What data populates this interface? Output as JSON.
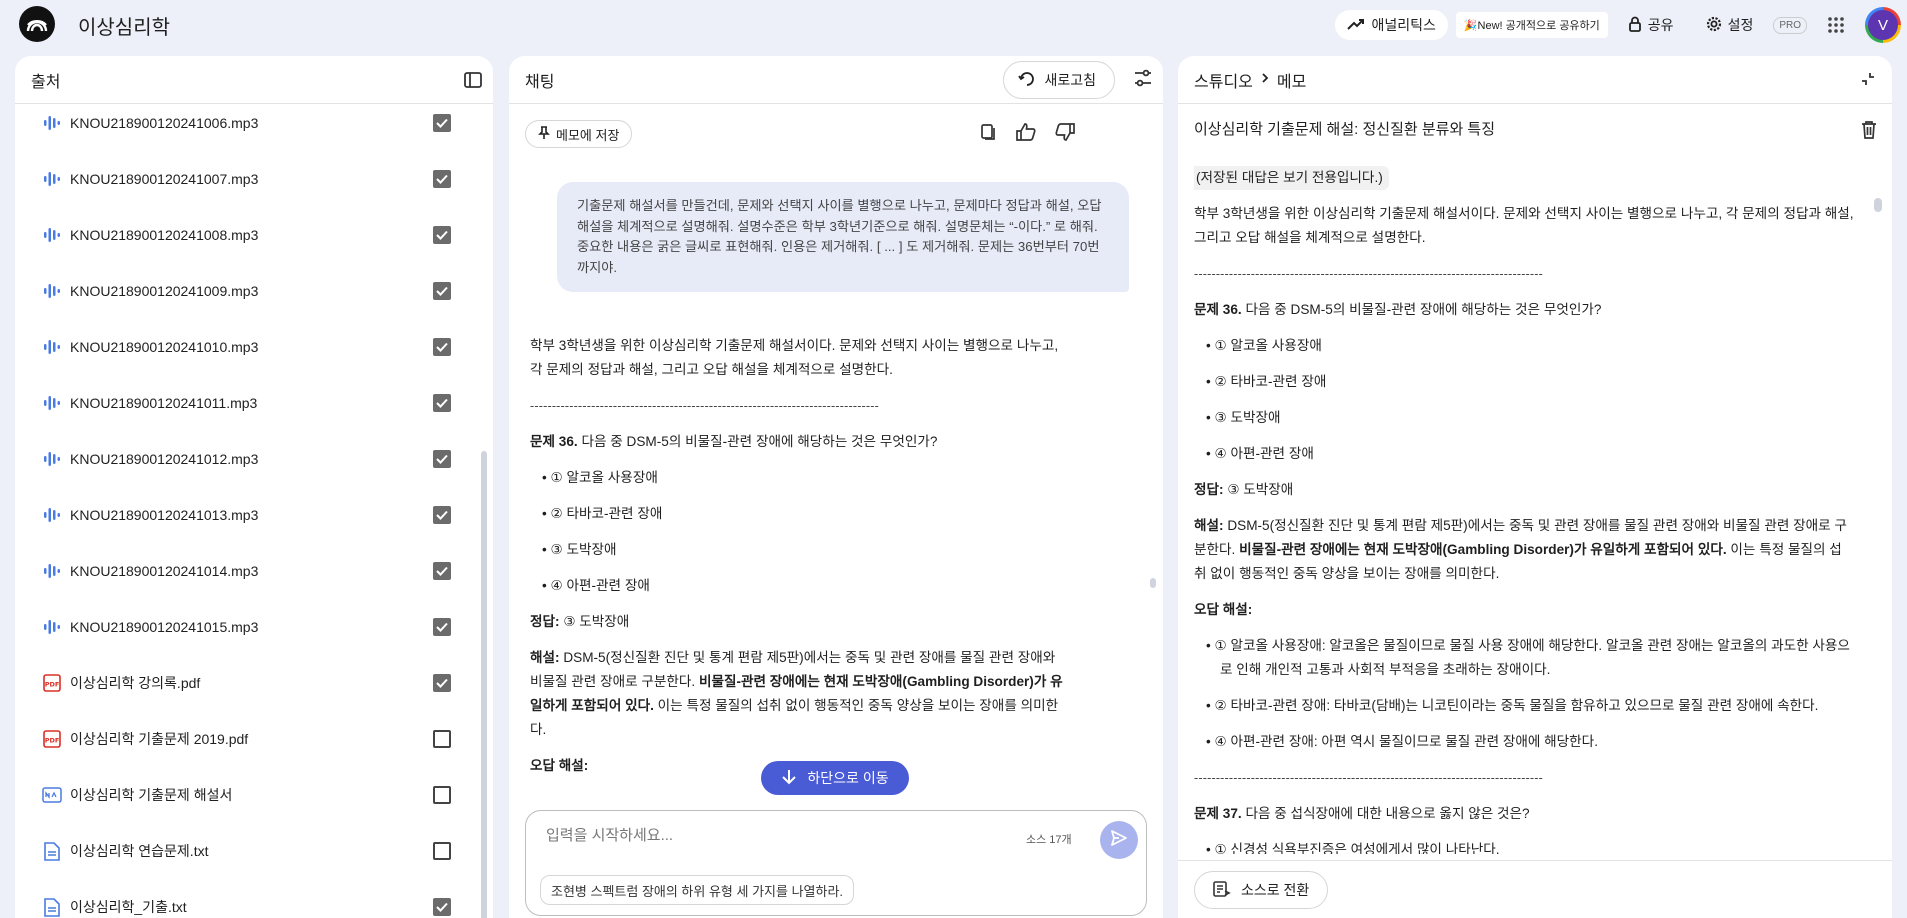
{
  "header": {
    "app_title": "이상심리학",
    "analytics_label": "애널리틱스",
    "new_share_label": "🎉New! 공개적으로 공유하기",
    "share_label": "공유",
    "settings_label": "설정",
    "pro_badge": "PRO",
    "avatar_letter": "V"
  },
  "sources": {
    "title": "출처",
    "items": [
      {
        "name": "KNOU218900120241006.mp3",
        "type": "audio",
        "checked": true
      },
      {
        "name": "KNOU218900120241007.mp3",
        "type": "audio",
        "checked": true
      },
      {
        "name": "KNOU218900120241008.mp3",
        "type": "audio",
        "checked": true
      },
      {
        "name": "KNOU218900120241009.mp3",
        "type": "audio",
        "checked": true
      },
      {
        "name": "KNOU218900120241010.mp3",
        "type": "audio",
        "checked": true
      },
      {
        "name": "KNOU218900120241011.mp3",
        "type": "audio",
        "checked": true
      },
      {
        "name": "KNOU218900120241012.mp3",
        "type": "audio",
        "checked": true
      },
      {
        "name": "KNOU218900120241013.mp3",
        "type": "audio",
        "checked": true
      },
      {
        "name": "KNOU218900120241014.mp3",
        "type": "audio",
        "checked": true
      },
      {
        "name": "KNOU218900120241015.mp3",
        "type": "audio",
        "checked": true
      },
      {
        "name": "이상심리학 강의록.pdf",
        "type": "pdf",
        "checked": true
      },
      {
        "name": "이상심리학 기출문제 2019.pdf",
        "type": "pdf",
        "checked": false
      },
      {
        "name": "이상심리학 기출문제 해설서",
        "type": "note",
        "checked": false
      },
      {
        "name": "이상심리학 연습문제.txt",
        "type": "text",
        "checked": false
      },
      {
        "name": "이상심리학_기출.txt",
        "type": "text",
        "checked": true
      }
    ]
  },
  "chat": {
    "title": "채팅",
    "refresh_label": "새로고침",
    "save_memo_label": "메모에 저장",
    "user_message": "기출문제 해설서를 만들건데, 문제와 선택지 사이를 별행으로 나누고, 문제마다 정답과 해설, 오답해설을 체계적으로 설명해줘. 설명수준은 학부 3학년기준으로 해줘. 설명문체는 “-이다.” 로 해줘. 중요한 내용은 굵은 글씨로 표현해줘. 인용은 제거해줘. [ ... ] 도 제거해줘. 문제는 36번부터 70번까지야.",
    "intro": "학부 3학년생을 위한 이상심리학 기출문제 해설서이다. 문제와 선택지 사이는 별행으로 나누고, 각 문제의 정답과 해설, 그리고 오답 해설을 체계적으로 설명한다.",
    "divider": "--------------------------------------------------------------------------------",
    "q_label": "문제 36.",
    "q_text": " 다음 중 DSM-5의 비물질-관련 장애에 해당하는 것은 무엇인가?",
    "opt1": "① 알코올 사용장애",
    "opt2": "② 타바코-관련 장애",
    "opt3": "③ 도박장애",
    "opt4": "④ 아편-관련 장애",
    "answer_label": "정답:",
    "answer_text": " ③ 도박장애",
    "exp_label": "해설:",
    "exp_text1": " DSM-5(정신질환 진단 및 통계 편람 제5판)에서는 중독 및 관련 장애를 물질 관련 장애와 비물질 관련 장애로 구분한다. ",
    "exp_bold": "비물질-관련 장애에는 현재 도박장애(Gambling Disorder)가 유일하게 포함되어 있다.",
    "exp_text2": " 이는 특정 물질의 섭취 없이 행동적인 중독 양상을 보이는 장애를 의미한다.",
    "wrong_label": "오답 해설:",
    "goto_bottom_label": "하단으로 이동",
    "input_placeholder": "입력을 시작하세요...",
    "source_count": "소스 17개",
    "suggestion": "조현병 스펙트럼 장애의 하위 유형 세 가지를 나열하라."
  },
  "studio": {
    "crumb_root": "스튜디오",
    "crumb_current": "메모",
    "note_title": "이상심리학 기출문제 해설: 정신질환 분류와 특징",
    "readonly_notice": "(저장된 대답은 보기 전용입니다.)",
    "intro": "학부 3학년생을 위한 이상심리학 기출문제 해설서이다. 문제와 선택지 사이는 별행으로 나누고, 각 문제의 정답과 해설, 그리고 오답 해설을 체계적으로 설명한다.",
    "divider": "--------------------------------------------------------------------------------",
    "q36_label": "문제 36.",
    "q36_text": " 다음 중 DSM-5의 비물질-관련 장애에 해당하는 것은 무엇인가?",
    "opt1": "① 알코올 사용장애",
    "opt2": "② 타바코-관련 장애",
    "opt3": "③ 도박장애",
    "opt4": "④ 아편-관련 장애",
    "answer_label": "정답:",
    "answer_text": " ③ 도박장애",
    "exp_label": "해설:",
    "exp_text1": " DSM-5(정신질환 진단 및 통계 편람 제5판)에서는 중독 및 관련 장애를 물질 관련 장애와 비물질 관련 장애로 구분한다. ",
    "exp_bold": "비물질-관련 장애에는 현재 도박장애(Gambling Disorder)가 유일하게 포함되어 있다.",
    "exp_text2": " 이는 특정 물질의 섭취 없이 행동적인 중독 양상을 보이는 장애를 의미한다.",
    "wrong_label": "오답 해설:",
    "wrong1": "① 알코올 사용장애: 알코올은 물질이므로 물질 사용 장애에 해당한다. 알코올 관련 장애는 알코올의 과도한 사용으로 인해 개인적 고통과 사회적 부적응을 초래하는 장애이다.",
    "wrong2": "② 타바코-관련 장애: 타바코(담배)는 니코틴이라는 중독 물질을 함유하고 있으므로 물질 관련 장애에 속한다.",
    "wrong4": "④ 아편-관련 장애: 아편 역시 물질이므로 물질 관련 장애에 해당한다.",
    "q37_label": "문제 37.",
    "q37_text": " 다음 중 섭식장애에 대한 내용으로 옳지 않은 것은?",
    "q37_opt1": "① 신경성 식욕부진증은 여성에게서 많이 나타난다.",
    "to_source_label": "소스로 전환"
  },
  "colors": {
    "background": "#eef0f9",
    "accent": "#4a5bd6",
    "audio_icon": "#4a7be0",
    "pdf_icon": "#d93025"
  }
}
